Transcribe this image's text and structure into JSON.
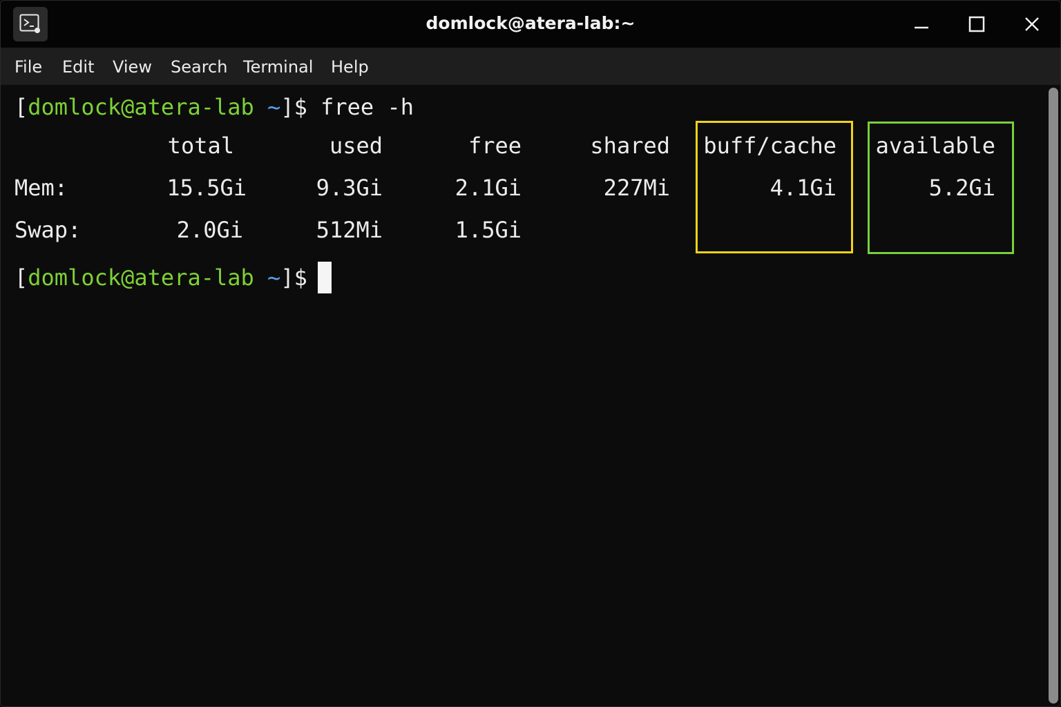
{
  "window": {
    "title": "domlock@atera-lab:~",
    "app_icon": "terminal-icon",
    "controls": [
      "minimize-icon",
      "maximize-icon",
      "close-icon"
    ]
  },
  "menu": [
    "File",
    "Edit",
    "View",
    "Search",
    "Terminal",
    "Help"
  ],
  "prompt": {
    "open_bracket": "[",
    "user_host": "domlock@atera-lab",
    "dir": "~",
    "close": "]$"
  },
  "command": "free -h",
  "free_output": {
    "headers": [
      "total",
      "used",
      "free",
      "shared",
      "buff/cache",
      "available"
    ],
    "rows": [
      {
        "label": "Mem:",
        "values": [
          "15.5Gi",
          "9.3Gi",
          "2.1Gi",
          "227Mi",
          "4.1Gi",
          "5.2Gi"
        ]
      },
      {
        "label": "Swap:",
        "values": [
          "2.0Gi",
          "512Mi",
          "1.5Gi"
        ]
      }
    ]
  },
  "highlights": [
    {
      "column": "buff/cache",
      "color": "#f2d21a"
    },
    {
      "column": "available",
      "color": "#78d03a"
    }
  ],
  "colors": {
    "prompt_user": "#7dd135",
    "prompt_dir": "#5aa0ea",
    "background": "#0c0c0c",
    "text": "#ececec"
  }
}
